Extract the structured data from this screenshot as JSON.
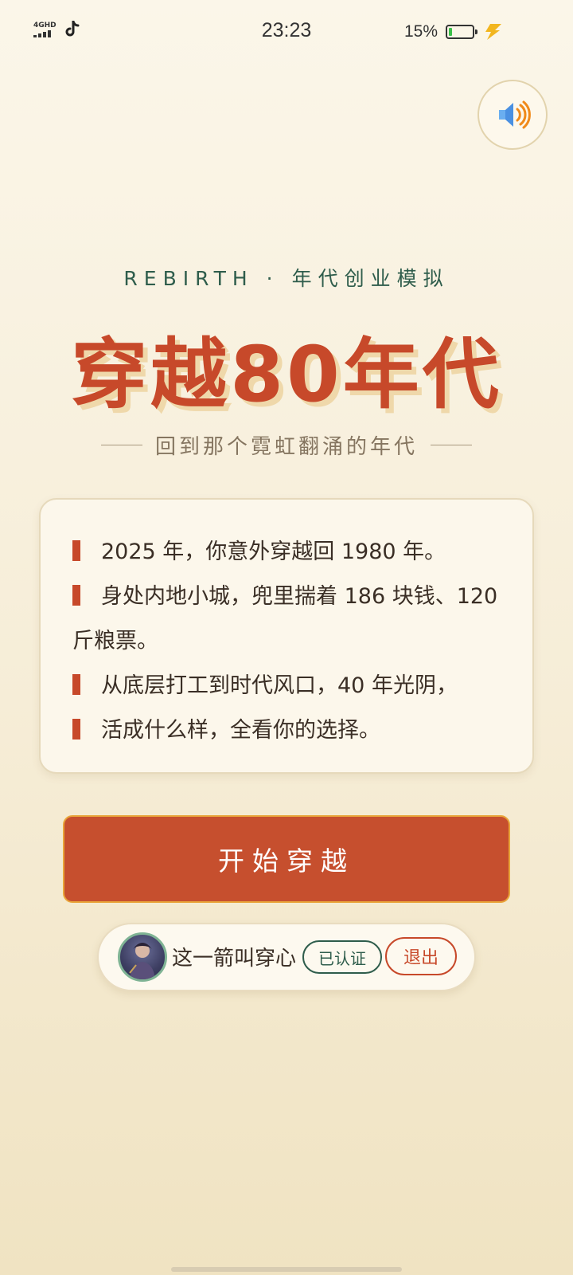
{
  "status_bar": {
    "network": "4GHD",
    "app_icon": "tiktok-icon",
    "time": "23:23",
    "battery_percent": "15%",
    "battery_level": 0.15,
    "charging_icon": "lightning-icon"
  },
  "sound": {
    "icon": "speaker-icon"
  },
  "header": {
    "subtitle": "REBIRTH · 年代创业模拟",
    "title": "穿越80年代",
    "tagline": "回到那个霓虹翻涌的年代"
  },
  "story": {
    "lines": [
      "2025 年，你意外穿越回 1980 年。",
      "身处内地小城，兜里揣着 186 块钱、120 斤粮票。",
      "从底层打工到时代风口，40 年光阴，",
      "活成什么样，全看你的选择。"
    ]
  },
  "actions": {
    "start_label": "开始穿越"
  },
  "user": {
    "name": "这一箭叫穿心",
    "verified_label": "已认证",
    "logout_label": "退出"
  },
  "colors": {
    "accent_red": "#c7492a",
    "accent_green": "#2f5d4c",
    "button_border": "#e9a53a",
    "background": "#fbf6e9"
  }
}
